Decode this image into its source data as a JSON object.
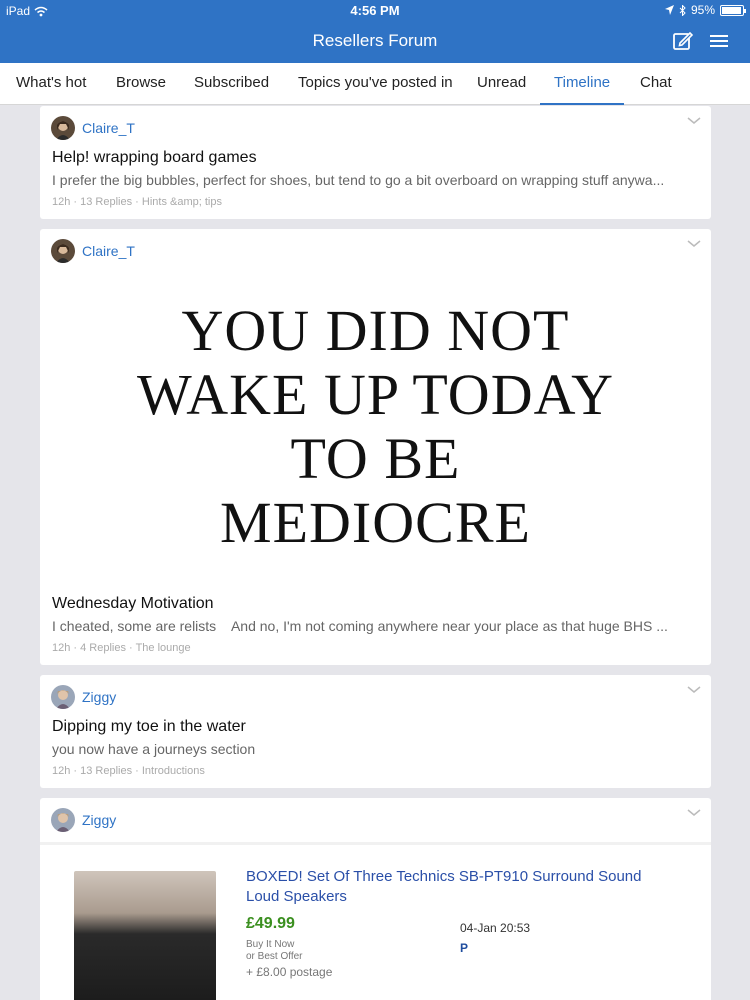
{
  "status_bar": {
    "device": "iPad",
    "time": "4:56 PM",
    "battery": "95%"
  },
  "header": {
    "title": "Resellers Forum"
  },
  "tabs": [
    {
      "label": "What's hot"
    },
    {
      "label": "Browse"
    },
    {
      "label": "Subscribed"
    },
    {
      "label": "Topics you've posted in"
    },
    {
      "label": "Unread"
    },
    {
      "label": "Timeline",
      "active": true
    },
    {
      "label": "Chat"
    }
  ],
  "posts": [
    {
      "author": "Claire_T",
      "title": "Help! wrapping board games",
      "snippet": "I prefer the big bubbles, perfect for shoes, but tend to go a bit overboard on wrapping stuff anywa...",
      "meta": "12h · 13 Replies · Hints &amp; tips"
    },
    {
      "author": "Claire_T",
      "image_text": [
        "YOU DID NOT",
        "WAKE UP TODAY",
        "TO BE",
        "MEDIOCRE"
      ],
      "title": "Wednesday Motivation",
      "snippet": "I cheated, some are relists    And no, I'm not coming anywhere near your place as that huge BHS ...",
      "meta": "12h · 4 Replies · The lounge"
    },
    {
      "author": "Ziggy",
      "title": "Dipping my toe in the water",
      "snippet": "you now have a journeys section",
      "meta": "12h · 13 Replies · Introductions"
    },
    {
      "author": "Ziggy",
      "listing": {
        "title": "BOXED! Set Of Three Technics SB-PT910 Surround Sound Loud Speakers",
        "price": "£49.99",
        "buy_it_now": "Buy It Now",
        "best_offer": "or Best Offer",
        "postage": "+ £8.00 postage",
        "date": "04-Jan 20:53",
        "paypal": "P"
      }
    }
  ],
  "colors": {
    "brand": "#2f73c5",
    "background": "#e5e5ea"
  }
}
